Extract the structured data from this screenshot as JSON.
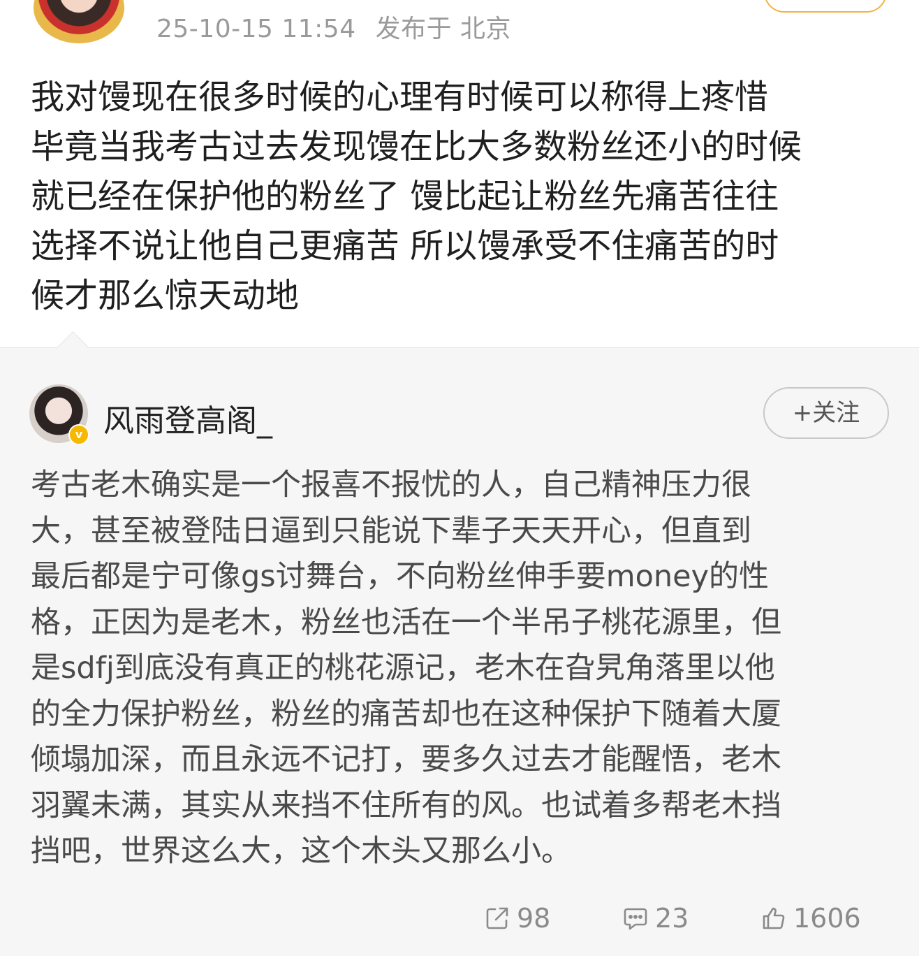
{
  "post": {
    "timestamp": "25-10-15 11:54",
    "location": "发布于 北京",
    "lines": [
      "我对馒现在很多时候的心理有时候可以称得上疼惜",
      "毕竟当我考古过去发现馒在比大多数粉丝还小的时候",
      "就已经在保护他的粉丝了 馒比起让粉丝先痛苦往往",
      "选择不说让他自己更痛苦 所以馒承受不住痛苦的时",
      "候才那么惊天动地"
    ]
  },
  "quoted": {
    "username": "风雨登高阁_",
    "verified_badge": "v",
    "follow_label": "+关注",
    "lines": [
      "考古老木确实是一个报喜不报忧的人，自己精神压力很",
      "大，甚至被登陆日逼到只能说下辈子天天开心，但直到",
      "最后都是宁可像gs讨舞台，不向粉丝伸手要money的性",
      "格，正因为是老木，粉丝也活在一个半吊子桃花源里，但",
      "是sdfj到底没有真正的桃花源记，老木在旮旯角落里以他",
      "的全力保护粉丝，粉丝的痛苦却也在这种保护下随着大厦",
      "倾塌加深，而且永远不记打，要多久过去才能醒悟，老木",
      "羽翼未满，其实从来挡不住所有的风。也试着多帮老木挡",
      "挡吧，世界这么大，这个木头又那么小。"
    ],
    "actions": {
      "repost_count": "98",
      "comment_count": "23",
      "like_count": "1606"
    }
  },
  "colors": {
    "accent_follow_border": "#f2b441",
    "verified_badge": "#f6b800",
    "meta_text": "#9a9a9a",
    "card_bg": "#f6f6f6"
  },
  "icons": [
    "repost-icon",
    "comment-icon",
    "like-icon",
    "verified-icon"
  ]
}
